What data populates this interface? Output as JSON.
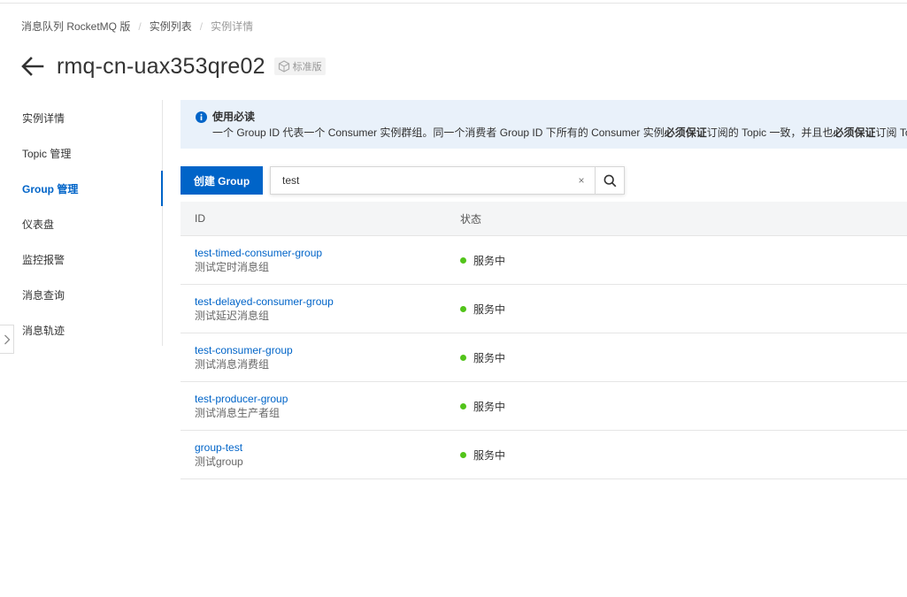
{
  "breadcrumb": [
    "消息队列 RocketMQ 版",
    "实例列表",
    "实例详情"
  ],
  "header": {
    "title": "rmq-cn-uax353qre02",
    "edition_badge": "标准版"
  },
  "sidebar": {
    "items": [
      {
        "label": "实例详情",
        "active": false
      },
      {
        "label": "Topic 管理",
        "active": false
      },
      {
        "label": "Group 管理",
        "active": true
      },
      {
        "label": "仪表盘",
        "active": false
      },
      {
        "label": "监控报警",
        "active": false
      },
      {
        "label": "消息查询",
        "active": false
      },
      {
        "label": "消息轨迹",
        "active": false
      }
    ]
  },
  "notice": {
    "title": "使用必读",
    "body_parts": [
      "一个 Group ID 代表一个 Consumer 实例群组。同一个消费者 Group ID 下所有的 Consumer 实例",
      "必须保证",
      "订阅的 Topic 一致，并且也",
      "必须保证",
      "订阅 Topic"
    ]
  },
  "toolbar": {
    "create_label": "创建 Group",
    "search_value": "test",
    "clear_symbol": "×"
  },
  "table": {
    "columns": [
      "ID",
      "状态"
    ],
    "rows": [
      {
        "id": "test-timed-consumer-group",
        "desc": "测试定时消息组",
        "status": "服务中"
      },
      {
        "id": "test-delayed-consumer-group",
        "desc": "测试延迟消息组",
        "status": "服务中"
      },
      {
        "id": "test-consumer-group",
        "desc": "测试消息消费组",
        "status": "服务中"
      },
      {
        "id": "test-producer-group",
        "desc": "测试消息生产者组",
        "status": "服务中"
      },
      {
        "id": "group-test",
        "desc": "测试group",
        "status": "服务中"
      }
    ]
  },
  "colors": {
    "accent": "#0064c8",
    "status_running": "#52c41a",
    "notice_bg": "#e9f1fa"
  },
  "icons": {
    "back": "arrow-left-icon",
    "info": "info-icon",
    "search": "search-icon",
    "clear": "close-icon",
    "collapse": "chevron-right-icon"
  }
}
